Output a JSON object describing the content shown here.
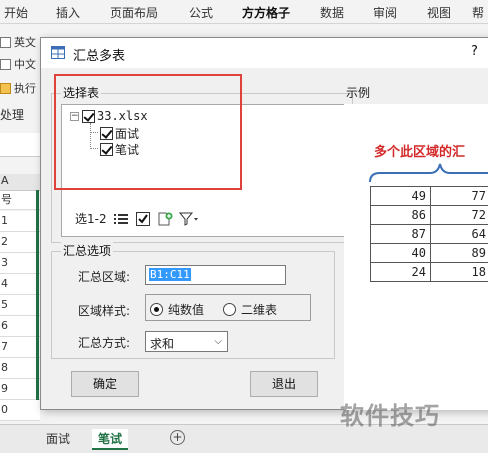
{
  "ribbon": {
    "tabs": [
      "开始",
      "插入",
      "页面布局",
      "公式",
      "方方格子",
      "数据",
      "审阅",
      "视图",
      "帮"
    ],
    "active_tab": "方方格子",
    "items": [
      "英文",
      "中文",
      "执行"
    ],
    "section": "处理"
  },
  "sheet": {
    "col_label": "A",
    "col_header": "号",
    "row_numbers": [
      "1",
      "2",
      "3",
      "4",
      "5",
      "6",
      "7",
      "8",
      "9",
      "0"
    ]
  },
  "sheet_tabs": [
    "面试",
    "笔试"
  ],
  "active_sheet": "笔试",
  "dialog": {
    "title": "汇总多表",
    "help": "?",
    "select_group": "选择表",
    "tree": {
      "file": "33.xlsx",
      "sheets": [
        "面试",
        "笔试"
      ]
    },
    "toolbar_label": "选1-2",
    "summary_group": "汇总选项",
    "range_label": "汇总区域:",
    "range_value": "B1:C11",
    "style_label": "区域样式:",
    "style_options": [
      "纯数值",
      "二维表"
    ],
    "method_label": "汇总方式:",
    "method_value": "求和",
    "ok_label": "确定",
    "exit_label": "退出",
    "example_label": "示例",
    "example_title": "多个此区域的汇",
    "example_rows": [
      [
        "49",
        "77"
      ],
      [
        "86",
        "72"
      ],
      [
        "87",
        "64"
      ],
      [
        "40",
        "89"
      ],
      [
        "24",
        "18"
      ]
    ]
  },
  "watermark": "软件技巧",
  "colors": {
    "accent": "#217346",
    "highlight": "#e0413a",
    "example_title": "#d42a2a"
  }
}
